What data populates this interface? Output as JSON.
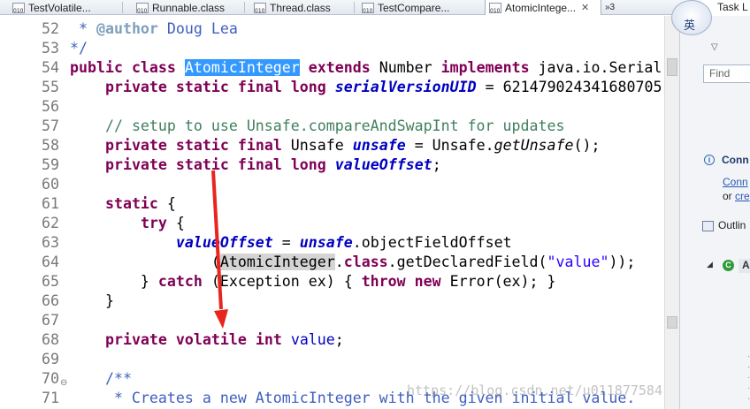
{
  "tabs": [
    {
      "label": "TestVolatile...",
      "icon": "java-file-icon",
      "active": false
    },
    {
      "label": "Runnable.class",
      "icon": "class-file-icon",
      "active": false
    },
    {
      "label": "Thread.class",
      "icon": "class-file-icon",
      "active": false
    },
    {
      "label": "TestCompare...",
      "icon": "java-file-icon",
      "active": false
    },
    {
      "label": "AtomicIntege...",
      "icon": "class-file-icon",
      "active": true,
      "close": "✕"
    }
  ],
  "tab_overflow": "»3",
  "editor": {
    "lines": [
      {
        "n": "52",
        "segments": [
          [
            "jd",
            " * "
          ],
          [
            "tag",
            "@author"
          ],
          [
            "jd",
            " Doug Lea"
          ]
        ]
      },
      {
        "n": "53",
        "segments": [
          [
            "jd",
            "*/"
          ]
        ]
      },
      {
        "n": "54",
        "segments": [
          [
            "kw",
            "public"
          ],
          [
            "",
            ""
          ],
          [
            "txt",
            " "
          ],
          [
            "kw",
            "class"
          ],
          [
            "txt",
            " "
          ],
          [
            "hl1",
            "AtomicInteger"
          ],
          [
            "txt",
            " "
          ],
          [
            "kw",
            "extends"
          ],
          [
            "txt",
            " Number "
          ],
          [
            "kw",
            "implements"
          ],
          [
            "txt",
            " java.io.Serial"
          ]
        ]
      },
      {
        "n": "55",
        "segments": [
          [
            "txt",
            "    "
          ],
          [
            "kw",
            "private"
          ],
          [
            "txt",
            " "
          ],
          [
            "kw",
            "static"
          ],
          [
            "txt",
            " "
          ],
          [
            "kw",
            "final"
          ],
          [
            "txt",
            " "
          ],
          [
            "kw",
            "long"
          ],
          [
            "txt",
            " "
          ],
          [
            "fsb",
            "serialVersionUID"
          ],
          [
            "txt",
            " = 621479024341680705"
          ]
        ]
      },
      {
        "n": "56",
        "segments": []
      },
      {
        "n": "57",
        "segments": [
          [
            "txt",
            "    "
          ],
          [
            "cm",
            "// setup to use Unsafe.compareAndSwapInt for updates"
          ]
        ]
      },
      {
        "n": "58",
        "segments": [
          [
            "txt",
            "    "
          ],
          [
            "kw",
            "private"
          ],
          [
            "txt",
            " "
          ],
          [
            "kw",
            "static"
          ],
          [
            "txt",
            " "
          ],
          [
            "kw",
            "final"
          ],
          [
            "txt",
            " Unsafe "
          ],
          [
            "fsb",
            "unsafe"
          ],
          [
            "txt",
            " = Unsafe."
          ],
          [
            "sm",
            "getUnsafe"
          ],
          [
            "txt",
            "();"
          ]
        ]
      },
      {
        "n": "59",
        "segments": [
          [
            "txt",
            "    "
          ],
          [
            "kw",
            "private"
          ],
          [
            "txt",
            " "
          ],
          [
            "kw",
            "static"
          ],
          [
            "txt",
            " "
          ],
          [
            "kw",
            "final"
          ],
          [
            "txt",
            " "
          ],
          [
            "kw",
            "long"
          ],
          [
            "txt",
            " "
          ],
          [
            "fsb",
            "valueOffset"
          ],
          [
            "txt",
            ";"
          ]
        ]
      },
      {
        "n": "60",
        "segments": []
      },
      {
        "n": "61",
        "segments": [
          [
            "txt",
            "    "
          ],
          [
            "kw",
            "static"
          ],
          [
            "txt",
            " {"
          ]
        ]
      },
      {
        "n": "62",
        "segments": [
          [
            "txt",
            "        "
          ],
          [
            "kw",
            "try"
          ],
          [
            "txt",
            " {"
          ]
        ]
      },
      {
        "n": "63",
        "segments": [
          [
            "txt",
            "            "
          ],
          [
            "fsb",
            "valueOffset"
          ],
          [
            "txt",
            " = "
          ],
          [
            "fsb",
            "unsafe"
          ],
          [
            "txt",
            ".objectFieldOffset"
          ]
        ]
      },
      {
        "n": "64",
        "segments": [
          [
            "txt",
            "                ("
          ],
          [
            "hl2",
            "AtomicInteger"
          ],
          [
            "txt",
            "."
          ],
          [
            "kw",
            "class"
          ],
          [
            "txt",
            ".getDeclaredField("
          ],
          [
            "str",
            "\"value\""
          ],
          [
            "txt",
            "));"
          ]
        ]
      },
      {
        "n": "65",
        "segments": [
          [
            "txt",
            "        } "
          ],
          [
            "kw",
            "catch"
          ],
          [
            "txt",
            " (Exception ex) { "
          ],
          [
            "kw",
            "throw"
          ],
          [
            "txt",
            " "
          ],
          [
            "kw",
            "new"
          ],
          [
            "txt",
            " Error(ex); }"
          ]
        ]
      },
      {
        "n": "66",
        "segments": [
          [
            "txt",
            "    }"
          ]
        ]
      },
      {
        "n": "67",
        "segments": []
      },
      {
        "n": "68",
        "segments": [
          [
            "txt",
            "    "
          ],
          [
            "kw",
            "private"
          ],
          [
            "txt",
            " "
          ],
          [
            "kw",
            "volatile"
          ],
          [
            "txt",
            " "
          ],
          [
            "kw",
            "int"
          ],
          [
            "txt",
            " "
          ],
          [
            "fi",
            "value"
          ],
          [
            "txt",
            ";"
          ]
        ]
      },
      {
        "n": "69",
        "segments": []
      },
      {
        "n": "70",
        "segments": [
          [
            "txt",
            "    "
          ],
          [
            "jd",
            "/**"
          ]
        ],
        "fold": "⊖"
      },
      {
        "n": "71",
        "segments": [
          [
            "jd",
            "     * Creates a new AtomicInteger with the given initial value."
          ]
        ]
      }
    ]
  },
  "right_panel": {
    "task_list_tab": "Task L",
    "find_placeholder": "Find",
    "connect_header": "Conn",
    "connect_link": "Conn",
    "connect_or": "or ",
    "connect_or_link": "cre",
    "outline_header": "Outlin",
    "outline_item": "A",
    "dots": "·\n·\n·\n·\n·"
  },
  "ime": {
    "label": "英"
  },
  "watermark": "https://blog.csdn.net/u011877584"
}
